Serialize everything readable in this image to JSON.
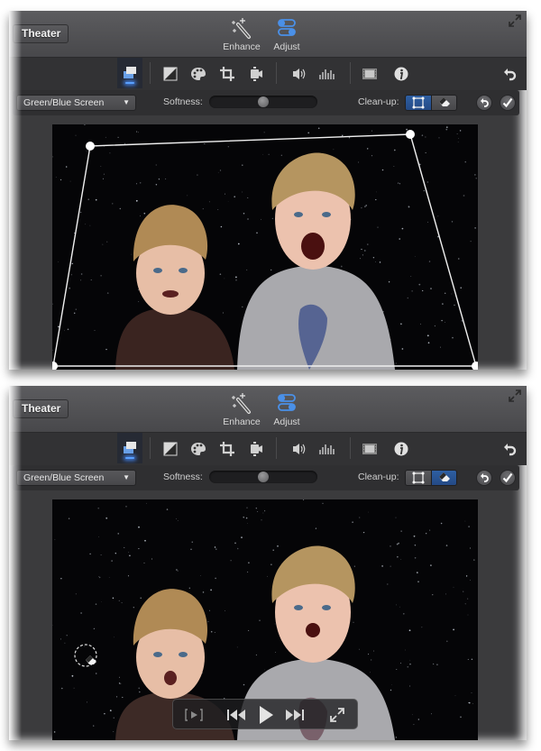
{
  "panels": [
    {
      "id": "before",
      "header": {
        "theater_label": "Theater",
        "tools": [
          {
            "name": "enhance",
            "label": "Enhance",
            "icon": "magic-wand-icon",
            "selected": false
          },
          {
            "name": "adjust",
            "label": "Adjust",
            "icon": "adjust-toggles-icon",
            "selected": true
          }
        ],
        "fullscreen_icon": "expand-arrows-icon"
      },
      "toolbar": {
        "icons": [
          "video-overlay-icon",
          "color-balance-icon",
          "color-palette-icon",
          "crop-icon",
          "stabilization-camera-icon",
          "volume-icon",
          "equalizer-icon",
          "clip-filter-icon",
          "info-icon"
        ],
        "selected": "video-overlay-icon",
        "reset_icon": "reset-arrow-icon"
      },
      "options": {
        "overlay_mode": "Green/Blue Screen",
        "softness_label": "Softness:",
        "softness_value": 0.5,
        "cleanup_label": "Clean-up:",
        "cleanup_tools": [
          "crop-corners-icon",
          "eraser-icon"
        ],
        "cleanup_selected": "crop-corners-icon",
        "undo_icon": "undo-arrow-icon",
        "apply_icon": "checkmark-icon"
      },
      "viewer": {
        "crop_handles": 4,
        "eraser_cursor": false,
        "playback_hud": false
      }
    },
    {
      "id": "after",
      "header": {
        "theater_label": "Theater",
        "tools": [
          {
            "name": "enhance",
            "label": "Enhance",
            "icon": "magic-wand-icon",
            "selected": false
          },
          {
            "name": "adjust",
            "label": "Adjust",
            "icon": "adjust-toggles-icon",
            "selected": true
          }
        ],
        "fullscreen_icon": "expand-arrows-icon"
      },
      "toolbar": {
        "icons": [
          "video-overlay-icon",
          "color-balance-icon",
          "color-palette-icon",
          "crop-icon",
          "stabilization-camera-icon",
          "volume-icon",
          "equalizer-icon",
          "clip-filter-icon",
          "info-icon"
        ],
        "selected": "video-overlay-icon",
        "reset_icon": "reset-arrow-icon"
      },
      "options": {
        "overlay_mode": "Green/Blue Screen",
        "softness_label": "Softness:",
        "softness_value": 0.5,
        "cleanup_label": "Clean-up:",
        "cleanup_tools": [
          "crop-corners-icon",
          "eraser-icon"
        ],
        "cleanup_selected": "eraser-icon",
        "undo_icon": "undo-arrow-icon",
        "apply_icon": "checkmark-icon"
      },
      "viewer": {
        "crop_handles": 0,
        "eraser_cursor": true,
        "playback_hud": true,
        "hud_controls": [
          "play-selection-icon",
          "skip-back-icon",
          "play-icon",
          "skip-forward-icon",
          "fullscreen-icon"
        ]
      }
    }
  ],
  "colors": {
    "accent_blue": "#4a90e8",
    "selected_segment": "#2e5fa3",
    "panel_bg": "#3b3b3d"
  }
}
